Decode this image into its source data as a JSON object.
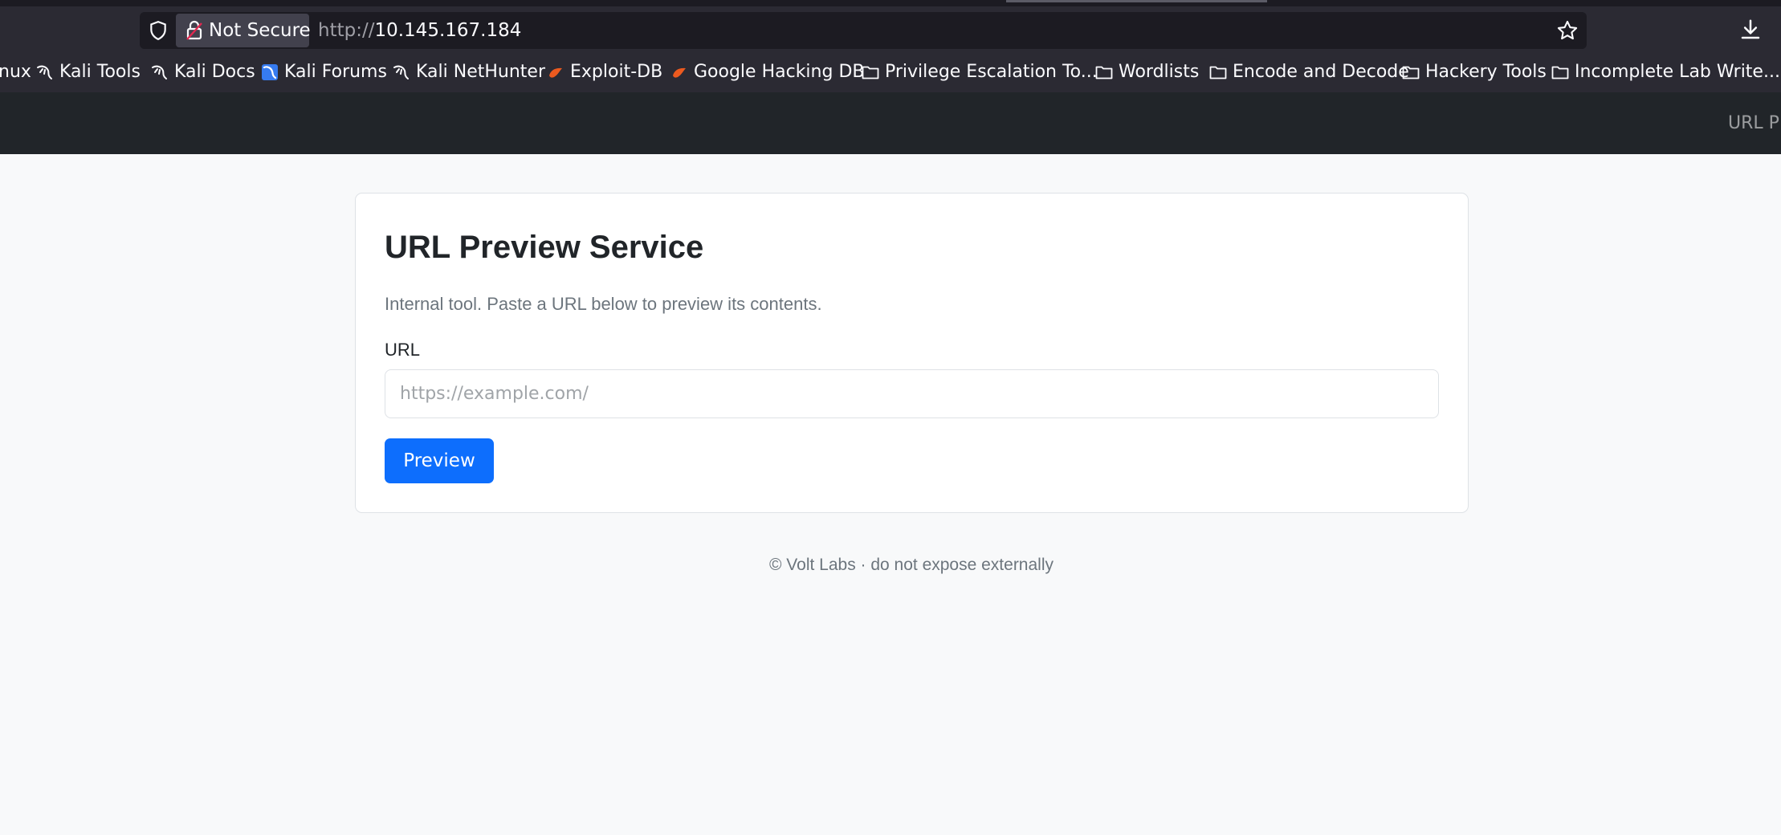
{
  "browser": {
    "security_label": "Not Secure",
    "url_scheme": "http://",
    "url_host": "10.145.167.184",
    "bookmarks": [
      {
        "label": "nux",
        "icon": "kali-dragon-icon"
      },
      {
        "label": "Kali Tools",
        "icon": "kali-dragon-icon"
      },
      {
        "label": "Kali Docs",
        "icon": "kali-dragon-icon"
      },
      {
        "label": "Kali Forums",
        "icon": "kali-forums-icon"
      },
      {
        "label": "Kali NetHunter",
        "icon": "kali-dragon-icon"
      },
      {
        "label": "Exploit-DB",
        "icon": "exploit-db-icon"
      },
      {
        "label": "Google Hacking DB",
        "icon": "exploit-db-icon"
      },
      {
        "label": "Privilege Escalation To...",
        "icon": "folder-icon"
      },
      {
        "label": "Wordlists",
        "icon": "folder-icon"
      },
      {
        "label": "Encode and Decode",
        "icon": "folder-icon"
      },
      {
        "label": "Hackery Tools",
        "icon": "folder-icon"
      },
      {
        "label": "Incomplete Lab Write...",
        "icon": "folder-icon"
      }
    ]
  },
  "navbar": {
    "brand": "URL P"
  },
  "card": {
    "title": "URL Preview Service",
    "description": "Internal tool. Paste a URL below to preview its contents.",
    "url_label": "URL",
    "url_placeholder": "https://example.com/",
    "url_value": "",
    "submit_label": "Preview"
  },
  "footer": {
    "text": "© Volt Labs · do not expose externally"
  },
  "colors": {
    "primary": "#0d6efd",
    "navbar": "#212529",
    "page_background": "#f8f9fa",
    "browser_chrome": "#2b2a33"
  }
}
